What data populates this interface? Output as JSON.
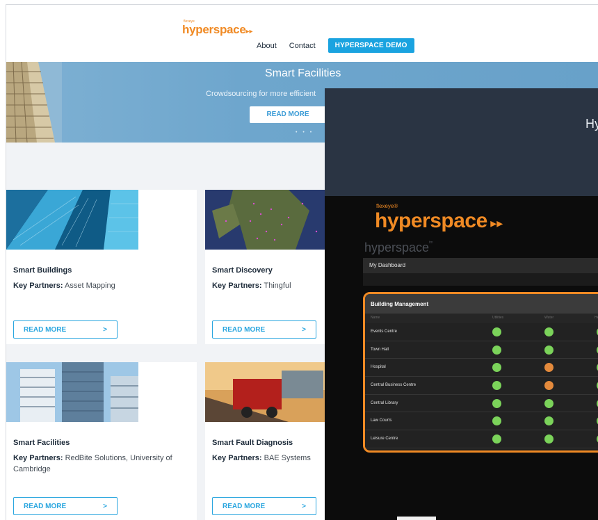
{
  "site": {
    "logo_tagline": "flexeye",
    "logo_word": "hyperspace",
    "logo_arrows": "▸▸",
    "nav": {
      "about": "About",
      "contact": "Contact",
      "demo": "HYPERSPACE DEMO"
    },
    "hero": {
      "title": "Smart Facilities",
      "subtitle": "Crowdsourcing for more efficient",
      "button": "READ MORE",
      "dots": "• • •"
    },
    "partners_label": "Key Partners:",
    "button_label": "READ MORE",
    "button_arrow": ">",
    "cards": [
      {
        "title": "Smart Buildings",
        "partners": "Asset Mapping"
      },
      {
        "title": "Smart Discovery",
        "partners": "Thingful"
      },
      {
        "title": "Smart Facilities",
        "partners": "RedBite Solutions, University of Cambridge"
      },
      {
        "title": "Smart Fault Diagnosis",
        "partners": "BAE Systems"
      }
    ]
  },
  "overlay": {
    "title": "Hy",
    "logo_small": "flexeye®",
    "logo_word": "hyperspace",
    "logo_arrows": "▸▸",
    "dash_logo": "hyperspace",
    "dash_logo_mark": "tm",
    "dashboard_label": "My Dashboard",
    "panel": {
      "title": "Building Management",
      "columns": [
        "Name",
        "Utilities",
        "Water",
        "He"
      ],
      "rows": [
        {
          "name": "Events Centre",
          "status": [
            "green",
            "green",
            "green"
          ]
        },
        {
          "name": "Town Hall",
          "status": [
            "green",
            "green",
            "green"
          ]
        },
        {
          "name": "Hospital",
          "status": [
            "green",
            "orange",
            "green"
          ]
        },
        {
          "name": "Central Business Centre",
          "status": [
            "green",
            "orange",
            "green"
          ]
        },
        {
          "name": "Central Library",
          "status": [
            "green",
            "green",
            "green"
          ]
        },
        {
          "name": "Law Courts",
          "status": [
            "green",
            "green",
            "green"
          ]
        },
        {
          "name": "Leisure Centre",
          "status": [
            "green",
            "green",
            "green"
          ]
        }
      ]
    }
  },
  "colors": {
    "brand_orange": "#f08a24",
    "accent_blue": "#1aa3e0",
    "status_green": "#7bd35a",
    "status_orange": "#e48a3c"
  }
}
